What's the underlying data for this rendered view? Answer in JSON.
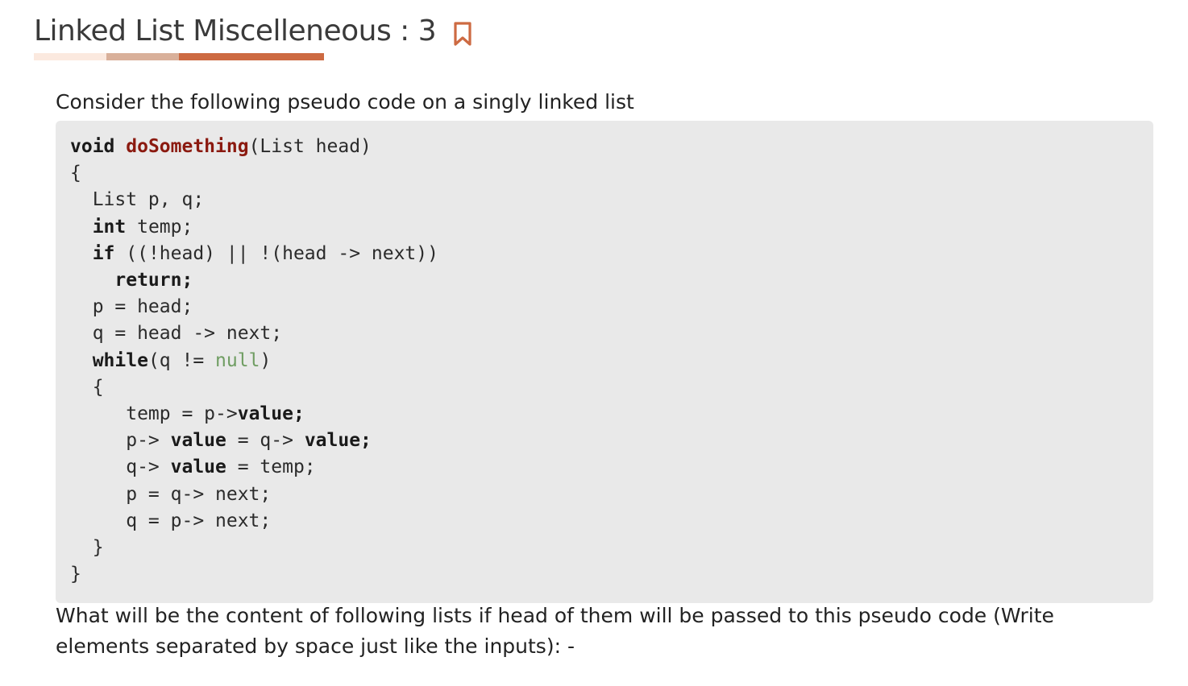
{
  "header": {
    "title": "Linked List Miscelleneous : 3",
    "bookmark_icon": "bookmark-icon",
    "accent_colors": [
      "#fbe9df",
      "#d9b09a",
      "#cd6a42"
    ]
  },
  "content": {
    "intro": "Consider the following pseudo code on a singly linked list",
    "code": {
      "line_1": {
        "kw": "void",
        "fn": "doSomething",
        "rest": "(List head)"
      },
      "line_2": "{",
      "line_3": "  List p, q;",
      "line_4": {
        "indent": "  ",
        "kw": "int",
        "rest": " temp;"
      },
      "line_5": {
        "indent": "  ",
        "kw": "if",
        "rest": " ((!head) || !(head -> next))"
      },
      "line_6": {
        "indent": "    ",
        "kw": "return;"
      },
      "line_7": "  p = head;",
      "line_8": "  q = head -> next;",
      "line_9": {
        "indent": "  ",
        "kw": "while",
        "mid": "(q != ",
        "lit": "null",
        "rest": ")"
      },
      "line_10": "  {",
      "line_11": {
        "pre": "     temp = p->",
        "kw": "value;"
      },
      "line_12": {
        "pre": "     p-> ",
        "kw1": "value",
        "mid": " = q-> ",
        "kw2": "value;"
      },
      "line_13": {
        "pre": "     q-> ",
        "kw": "value",
        "rest": " = temp;"
      },
      "line_14": "     p = q-> next;",
      "line_15": "     q = p-> next;",
      "line_16": "  }",
      "line_17": "}"
    },
    "question": "What will be the content of following lists if head of them will be passed to this pseudo code (Write elements separated by space just like the inputs): -"
  }
}
